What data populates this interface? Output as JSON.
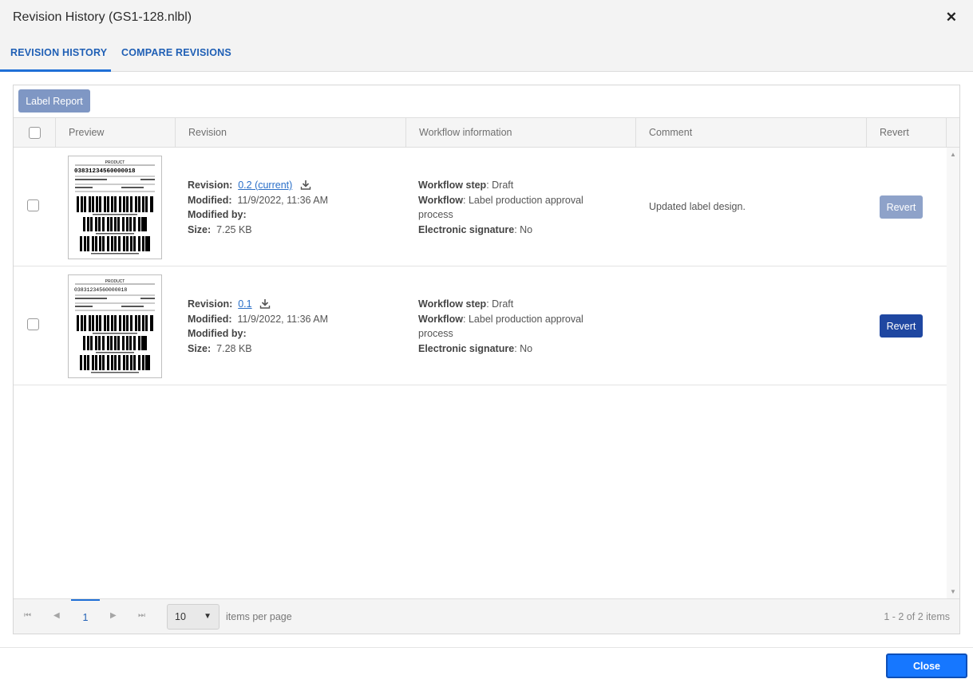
{
  "window": {
    "title": "Revision History (GS1-128.nlbl)",
    "close_glyph": "✕"
  },
  "tabs": [
    {
      "label": "REVISION HISTORY",
      "active": true
    },
    {
      "label": "COMPARE REVISIONS",
      "active": false
    }
  ],
  "toolbar": {
    "label_report": "Label Report"
  },
  "columns": {
    "preview": "Preview",
    "revision": "Revision",
    "workflow": "Workflow information",
    "comment": "Comment",
    "revert": "Revert"
  },
  "field_labels": {
    "revision": "Revision:",
    "modified": "Modified:",
    "modified_by": "Modified by:",
    "size": "Size:",
    "workflow_step": "Workflow step",
    "workflow": "Workflow",
    "electronic_signature": "Electronic signature"
  },
  "rows": [
    {
      "revision": "0.2 (current)",
      "modified": "11/9/2022, 11:36 AM",
      "modified_by": "",
      "size": "7.25 KB",
      "workflow_step": ": Draft",
      "workflow": ": Label production approval process",
      "electronic_signature": ": No",
      "comment": "Updated label design.",
      "revert_label": "Revert",
      "revert_enabled": false
    },
    {
      "revision": "0.1",
      "modified": "11/9/2022, 11:36 AM",
      "modified_by": "",
      "size": "7.28 KB",
      "workflow_step": ": Draft",
      "workflow": ": Label production approval process",
      "electronic_signature": ": No",
      "comment": "",
      "revert_label": "Revert",
      "revert_enabled": true
    }
  ],
  "thumbnail_text": {
    "header": "PRODUCT",
    "big_number": "03831234560000018"
  },
  "pager": {
    "current_page": "1",
    "page_size": "10",
    "items_per_page": "items per page",
    "count": "1 - 2 of 2 items"
  },
  "footer": {
    "close_label": "Close"
  },
  "colors": {
    "accent": "#1f6fd6",
    "revert_active": "#1f47a1",
    "revert_disabled": "#8ea2c9",
    "close_button": "#1677ff"
  }
}
